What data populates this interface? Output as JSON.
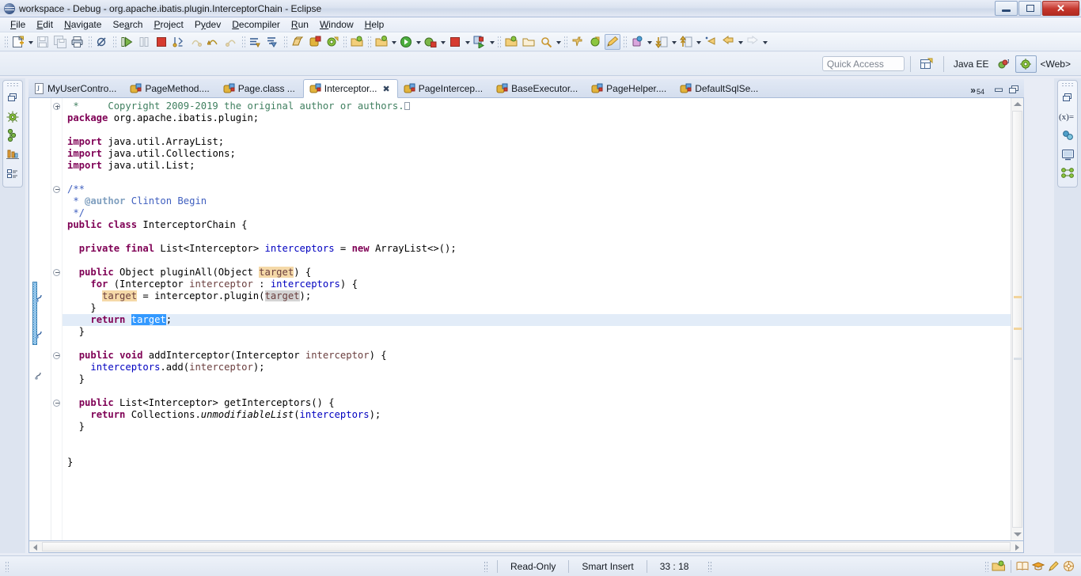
{
  "window": {
    "title": "workspace - Debug - org.apache.ibatis.plugin.InterceptorChain - Eclipse",
    "app_icon": "eclipse-icon",
    "minimize_label": "Minimize",
    "maximize_label": "Maximize",
    "close_label": "✕"
  },
  "menubar": {
    "items": [
      {
        "label": "File",
        "mnemonic": "F"
      },
      {
        "label": "Edit",
        "mnemonic": "E"
      },
      {
        "label": "Navigate",
        "mnemonic": "N"
      },
      {
        "label": "Search",
        "mnemonic": "a"
      },
      {
        "label": "Project",
        "mnemonic": "P"
      },
      {
        "label": "Pydev",
        "mnemonic": "y"
      },
      {
        "label": "Decompiler",
        "mnemonic": "D"
      },
      {
        "label": "Run",
        "mnemonic": "R"
      },
      {
        "label": "Window",
        "mnemonic": "W"
      },
      {
        "label": "Help",
        "mnemonic": "H"
      }
    ]
  },
  "toolbar": {
    "groups": [
      {
        "buttons": [
          {
            "name": "new-wizard-icon",
            "kind": "new",
            "enabled": true,
            "dropdown": true
          },
          {
            "name": "save-icon",
            "kind": "save",
            "enabled": false,
            "dropdown": false
          },
          {
            "name": "save-all-icon",
            "kind": "saveall",
            "enabled": false,
            "dropdown": false
          },
          {
            "name": "print-icon",
            "kind": "print",
            "enabled": true,
            "dropdown": false
          }
        ]
      },
      {
        "buttons": [
          {
            "name": "skip-all-breakpoints-icon",
            "kind": "skipbp",
            "enabled": true,
            "dropdown": false
          }
        ]
      },
      {
        "buttons": [
          {
            "name": "resume-icon",
            "kind": "resume",
            "enabled": true,
            "dropdown": false
          },
          {
            "name": "suspend-icon",
            "kind": "suspend",
            "enabled": false,
            "dropdown": false
          },
          {
            "name": "terminate-icon",
            "kind": "terminate",
            "enabled": true,
            "dropdown": false
          },
          {
            "name": "step-into-icon",
            "kind": "stepinto",
            "enabled": true,
            "dropdown": false
          },
          {
            "name": "step-over-icon",
            "kind": "stepover",
            "enabled": false,
            "dropdown": false
          },
          {
            "name": "step-return-icon",
            "kind": "stepret",
            "enabled": true,
            "dropdown": false
          },
          {
            "name": "drop-to-frame-icon",
            "kind": "dropframe",
            "enabled": false,
            "dropdown": false
          }
        ]
      },
      {
        "buttons": [
          {
            "name": "next-annotation-icon",
            "kind": "nextanno",
            "enabled": true,
            "dropdown": false
          },
          {
            "name": "prev-annotation-icon",
            "kind": "prevanno",
            "enabled": true,
            "dropdown": false
          }
        ]
      },
      {
        "buttons": [
          {
            "name": "new-java-package-icon",
            "kind": "pkg",
            "enabled": true,
            "dropdown": false
          },
          {
            "name": "new-java-class-icon",
            "kind": "class",
            "enabled": true,
            "dropdown": false
          },
          {
            "name": "new-java-project-icon",
            "kind": "proj",
            "enabled": true,
            "dropdown": false
          }
        ]
      },
      {
        "buttons": [
          {
            "name": "open-task-icon",
            "kind": "task",
            "enabled": true,
            "dropdown": false
          }
        ]
      },
      {
        "buttons": [
          {
            "name": "debug-ant-icon",
            "kind": "ant",
            "enabled": true,
            "dropdown": true
          },
          {
            "name": "run-icon",
            "kind": "run",
            "enabled": true,
            "dropdown": true
          },
          {
            "name": "debug-icon",
            "kind": "debug",
            "enabled": true,
            "dropdown": true
          },
          {
            "name": "coverage-stop-icon",
            "kind": "covstop",
            "enabled": true,
            "dropdown": true
          },
          {
            "name": "run-external-icon",
            "kind": "runext",
            "enabled": true,
            "dropdown": true
          }
        ]
      },
      {
        "buttons": [
          {
            "name": "open-type-icon",
            "kind": "opentype",
            "enabled": true,
            "dropdown": false
          },
          {
            "name": "open-resource-icon",
            "kind": "openres",
            "enabled": true,
            "dropdown": false
          },
          {
            "name": "search-icon",
            "kind": "search",
            "enabled": true,
            "dropdown": true
          }
        ]
      },
      {
        "buttons": [
          {
            "name": "pin-editor-icon",
            "kind": "pin",
            "enabled": true,
            "dropdown": false
          },
          {
            "name": "pydev-pkg-icon",
            "kind": "pydev",
            "enabled": true,
            "dropdown": false
          },
          {
            "name": "toggle-mark-occurrences-icon",
            "kind": "markocc",
            "enabled": true,
            "dropdown": false,
            "pressed": true
          }
        ]
      },
      {
        "buttons": [
          {
            "name": "toggle-breakpoint-icon",
            "kind": "togglebp",
            "enabled": true,
            "dropdown": true
          },
          {
            "name": "next-edit-icon",
            "kind": "nextedit",
            "enabled": true,
            "dropdown": true
          },
          {
            "name": "prev-edit-icon",
            "kind": "prevedit",
            "enabled": true,
            "dropdown": true
          },
          {
            "name": "back-history-icon",
            "kind": "back",
            "enabled": true,
            "dropdown": false
          },
          {
            "name": "back-arrow-icon",
            "kind": "backarrow",
            "enabled": true,
            "dropdown": true
          },
          {
            "name": "forward-arrow-icon",
            "kind": "fwdarrow",
            "enabled": false,
            "dropdown": true
          }
        ]
      }
    ]
  },
  "perspective_bar": {
    "quick_access_placeholder": "Quick Access",
    "open_perspective_label": "Open Perspective",
    "perspectives": [
      {
        "label": "Java EE",
        "icon": "java-ee-perspective-icon",
        "active": false
      },
      {
        "label": "",
        "icon": "debug-perspective-icon",
        "active": false
      },
      {
        "label": "<Web>",
        "icon": "web-perspective-icon",
        "active": true
      }
    ]
  },
  "left_fastview": {
    "items": [
      {
        "name": "restore-icon",
        "label": "Restore"
      },
      {
        "name": "debug-view-icon",
        "label": "Debug"
      },
      {
        "name": "breakpoints-view-icon",
        "label": "Breakpoints"
      },
      {
        "name": "servers-view-icon",
        "label": "Servers"
      },
      {
        "name": "outline-view-icon",
        "label": "Outline"
      }
    ]
  },
  "right_fastview": {
    "items": [
      {
        "name": "restore-icon",
        "label": "Restore"
      },
      {
        "name": "variables-view-icon",
        "label": "Variables"
      },
      {
        "name": "expressions-view-icon",
        "label": "Expressions"
      },
      {
        "name": "console-view-icon",
        "label": "Console"
      },
      {
        "name": "hierarchy-view-icon",
        "label": "Hierarchy"
      }
    ]
  },
  "editor": {
    "tabs": [
      {
        "label": "MyUserContro...",
        "icon": "java-file-icon",
        "active": false,
        "closable": false
      },
      {
        "label": "PageMethod....",
        "icon": "class-file-icon",
        "active": false,
        "closable": false
      },
      {
        "label": "Page.class ...",
        "icon": "class-file-icon",
        "active": false,
        "closable": false
      },
      {
        "label": "Interceptor...",
        "icon": "class-file-icon",
        "active": true,
        "closable": true
      },
      {
        "label": "PageIntercep...",
        "icon": "class-file-icon",
        "active": false,
        "closable": false
      },
      {
        "label": "BaseExecutor...",
        "icon": "class-file-icon",
        "active": false,
        "closable": false
      },
      {
        "label": "PageHelper....",
        "icon": "class-file-icon",
        "active": false,
        "closable": false
      },
      {
        "label": "DefaultSqlSe...",
        "icon": "class-file-icon",
        "active": false,
        "closable": false
      }
    ],
    "overflow_chevron": "»",
    "overflow_count": "54",
    "minimize_label": "Minimize",
    "maximize_label": "Maximize",
    "code_lines": [
      {
        "fold": "plus",
        "segments": [
          {
            "t": " *     Copyright 2009-2019 the original author or authors.",
            "c": "cmt"
          },
          {
            "t": "",
            "c": "eolbox"
          }
        ]
      },
      {
        "fold": "",
        "segments": [
          {
            "t": "package",
            "c": "kw"
          },
          {
            "t": " org.apache.ibatis.plugin;",
            "c": ""
          }
        ]
      },
      {
        "fold": "",
        "segments": []
      },
      {
        "fold": "",
        "segments": [
          {
            "t": "import",
            "c": "kw"
          },
          {
            "t": " java.util.ArrayList;",
            "c": ""
          }
        ]
      },
      {
        "fold": "",
        "segments": [
          {
            "t": "import",
            "c": "kw"
          },
          {
            "t": " java.util.Collections;",
            "c": ""
          }
        ]
      },
      {
        "fold": "",
        "segments": [
          {
            "t": "import",
            "c": "kw"
          },
          {
            "t": " java.util.List;",
            "c": ""
          }
        ]
      },
      {
        "fold": "",
        "segments": []
      },
      {
        "fold": "minus",
        "segments": [
          {
            "t": "/**",
            "c": "jdoc"
          }
        ]
      },
      {
        "fold": "",
        "segments": [
          {
            "t": " * ",
            "c": "jdoc"
          },
          {
            "t": "@author",
            "c": "jtag"
          },
          {
            "t": " Clinton Begin",
            "c": "jdoc"
          }
        ]
      },
      {
        "fold": "",
        "segments": [
          {
            "t": " */",
            "c": "jdoc"
          }
        ]
      },
      {
        "fold": "",
        "segments": [
          {
            "t": "public",
            "c": "kw"
          },
          {
            "t": " ",
            "c": ""
          },
          {
            "t": "class",
            "c": "kw"
          },
          {
            "t": " InterceptorChain {",
            "c": ""
          }
        ]
      },
      {
        "fold": "",
        "segments": []
      },
      {
        "fold": "",
        "segments": [
          {
            "t": "  ",
            "c": ""
          },
          {
            "t": "private",
            "c": "kw"
          },
          {
            "t": " ",
            "c": ""
          },
          {
            "t": "final",
            "c": "kw"
          },
          {
            "t": " List<Interceptor> ",
            "c": ""
          },
          {
            "t": "interceptors",
            "c": "fld"
          },
          {
            "t": " = ",
            "c": ""
          },
          {
            "t": "new",
            "c": "kw"
          },
          {
            "t": " ArrayList<>();",
            "c": ""
          }
        ]
      },
      {
        "fold": "",
        "segments": []
      },
      {
        "fold": "minus",
        "segments": [
          {
            "t": "  ",
            "c": ""
          },
          {
            "t": "public",
            "c": "kw"
          },
          {
            "t": " Object pluginAll(Object ",
            "c": ""
          },
          {
            "t": "target",
            "c": "prm occ"
          },
          {
            "t": ") {",
            "c": ""
          }
        ]
      },
      {
        "fold": "",
        "segments": [
          {
            "t": "    ",
            "c": ""
          },
          {
            "t": "for",
            "c": "kw"
          },
          {
            "t": " (Interceptor ",
            "c": ""
          },
          {
            "t": "interceptor",
            "c": "prm"
          },
          {
            "t": " : ",
            "c": ""
          },
          {
            "t": "interceptors",
            "c": "fld"
          },
          {
            "t": ") {",
            "c": ""
          }
        ]
      },
      {
        "fold": "",
        "segments": [
          {
            "t": "      ",
            "c": ""
          },
          {
            "t": "target",
            "c": "prm occ"
          },
          {
            "t": " = interceptor.plugin(",
            "c": ""
          },
          {
            "t": "target",
            "c": "prm occw"
          },
          {
            "t": ");",
            "c": ""
          }
        ]
      },
      {
        "fold": "",
        "segments": [
          {
            "t": "    }",
            "c": ""
          }
        ]
      },
      {
        "fold": "",
        "selected": true,
        "segments": [
          {
            "t": "    ",
            "c": ""
          },
          {
            "t": "return",
            "c": "kw"
          },
          {
            "t": " ",
            "c": ""
          },
          {
            "t": "target",
            "c": "sel"
          },
          {
            "t": ";",
            "c": ""
          }
        ]
      },
      {
        "fold": "",
        "segments": [
          {
            "t": "  }",
            "c": ""
          }
        ]
      },
      {
        "fold": "",
        "segments": []
      },
      {
        "fold": "minus",
        "segments": [
          {
            "t": "  ",
            "c": ""
          },
          {
            "t": "public",
            "c": "kw"
          },
          {
            "t": " ",
            "c": ""
          },
          {
            "t": "void",
            "c": "kw"
          },
          {
            "t": " addInterceptor(Interceptor ",
            "c": ""
          },
          {
            "t": "interceptor",
            "c": "prm"
          },
          {
            "t": ") {",
            "c": ""
          }
        ]
      },
      {
        "fold": "",
        "segments": [
          {
            "t": "    ",
            "c": ""
          },
          {
            "t": "interceptors",
            "c": "fld"
          },
          {
            "t": ".add(",
            "c": ""
          },
          {
            "t": "interceptor",
            "c": "prm"
          },
          {
            "t": ");",
            "c": ""
          }
        ]
      },
      {
        "fold": "",
        "segments": [
          {
            "t": "  }",
            "c": ""
          }
        ]
      },
      {
        "fold": "",
        "segments": []
      },
      {
        "fold": "minus",
        "segments": [
          {
            "t": "  ",
            "c": ""
          },
          {
            "t": "public",
            "c": "kw"
          },
          {
            "t": " List<Interceptor> getInterceptors() {",
            "c": ""
          }
        ]
      },
      {
        "fold": "",
        "segments": [
          {
            "t": "    ",
            "c": ""
          },
          {
            "t": "return",
            "c": "kw"
          },
          {
            "t": " Collections.",
            "c": ""
          },
          {
            "t": "unmodifiableList",
            "c": "stat"
          },
          {
            "t": "(",
            "c": ""
          },
          {
            "t": "interceptors",
            "c": "fld"
          },
          {
            "t": ");",
            "c": ""
          }
        ]
      },
      {
        "fold": "",
        "segments": [
          {
            "t": "  }",
            "c": ""
          }
        ]
      },
      {
        "fold": "",
        "segments": []
      },
      {
        "fold": "",
        "segments": []
      },
      {
        "fold": "",
        "segments": [
          {
            "t": "}",
            "c": ""
          }
        ]
      }
    ],
    "ruler_markers": [
      {
        "name": "breakpoint-jump-marker",
        "line": 15
      },
      {
        "name": "breakpoint-jump-marker",
        "line": 18
      },
      {
        "name": "quick-assist-marker",
        "line": 22
      }
    ]
  },
  "statusbar": {
    "read_only": "Read-Only",
    "insert_mode": "Smart Insert",
    "cursor_position": "33 : 18",
    "right_icons": [
      {
        "name": "open-perspective-shortcut-icon"
      },
      {
        "name": "book-icon"
      },
      {
        "name": "graduation-icon"
      },
      {
        "name": "pencil-icon"
      },
      {
        "name": "wheel-icon"
      }
    ]
  },
  "colors": {
    "keyword": "#7f0055",
    "comment": "#3f7f5f",
    "javadoc": "#3f5fbf",
    "field": "#0000c0",
    "parameter": "#6a3e3e",
    "occurrence_write": "#d4d4d4",
    "occurrence_read": "#f5d9a8",
    "selection": "#3399ff",
    "selected_line": "#e2ecf8",
    "titlebar_close": "#c4362c"
  }
}
